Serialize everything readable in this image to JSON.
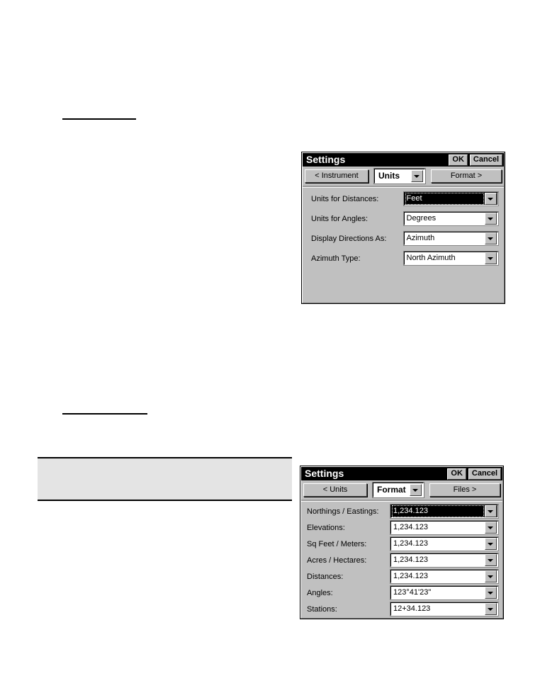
{
  "page": {
    "rules": [
      {
        "name": "rule-top"
      },
      {
        "name": "rule-mid"
      }
    ],
    "gray_box": {
      "content": ""
    }
  },
  "dialog_units": {
    "title": "Settings",
    "title_buttons": [
      {
        "id": "ok",
        "label": "OK"
      },
      {
        "id": "cancel",
        "label": "Cancel"
      }
    ],
    "nav": {
      "prev_label": "< Instrument",
      "current_label": "Units",
      "next_label": "Format >",
      "dropdown_icon": "chevron-down-icon"
    },
    "rows": [
      {
        "label": "Units for Distances:",
        "value": "Feet",
        "selected": true
      },
      {
        "label": "Units for Angles:",
        "value": "Degrees",
        "selected": false
      },
      {
        "label": "Display Directions As:",
        "value": "Azimuth",
        "selected": false
      },
      {
        "label": "Azimuth Type:",
        "value": "North Azimuth",
        "selected": false
      }
    ]
  },
  "dialog_format": {
    "title": "Settings",
    "title_buttons": [
      {
        "id": "ok",
        "label": "OK"
      },
      {
        "id": "cancel",
        "label": "Cancel"
      }
    ],
    "nav": {
      "prev_label": "< Units",
      "current_label": "Format",
      "next_label": "Files >",
      "dropdown_icon": "chevron-down-icon"
    },
    "rows": [
      {
        "label": "Northings / Eastings:",
        "value": "1,234.123",
        "selected": true
      },
      {
        "label": "Elevations:",
        "value": "1,234.123",
        "selected": false
      },
      {
        "label": "Sq Feet / Meters:",
        "value": "1,234.123",
        "selected": false
      },
      {
        "label": "Acres / Hectares:",
        "value": "1,234.123",
        "selected": false
      },
      {
        "label": "Distances:",
        "value": "1,234.123",
        "selected": false
      },
      {
        "label": "Angles:",
        "value": "123°41'23\"",
        "selected": false
      },
      {
        "label": "Stations:",
        "value": "12+34.123",
        "selected": false
      }
    ]
  },
  "colors": {
    "dialog_face": "#c0c0c0",
    "titlebar": "#000000",
    "field_bg": "#ffffff",
    "selection": "#000000",
    "gray_box": "#e4e4e4",
    "page_bg": "#ffffff"
  }
}
